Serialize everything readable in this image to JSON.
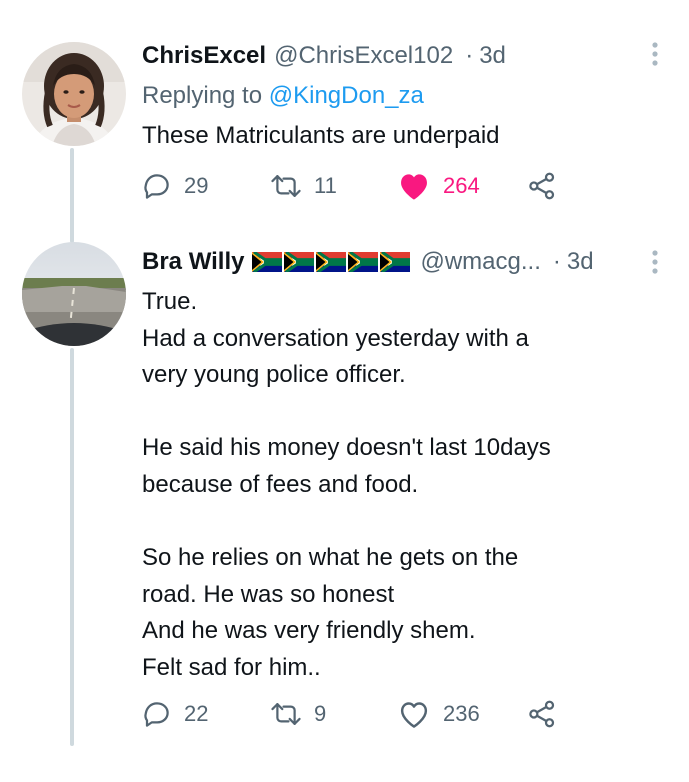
{
  "tweets": [
    {
      "name": "ChrisExcel",
      "handle": "@ChrisExcel102",
      "separator": "·",
      "time": "3d",
      "reply_prefix": "Replying to ",
      "reply_to": "@KingDon_za",
      "text": "These Matriculants are underpaid",
      "replies": "29",
      "retweets": "11",
      "likes": "264",
      "liked": true
    },
    {
      "name": "Bra Willy",
      "flags": [
        "south-africa-flag",
        "south-africa-flag",
        "south-africa-flag",
        "south-africa-flag",
        "south-africa-flag"
      ],
      "handle": "@wmacg...",
      "separator": "·",
      "time": "3d",
      "text": "True.\nHad a conversation yesterday with a\nvery young police officer.\n\nHe said his money doesn't last 10days\nbecause of fees and food.\n\nSo he relies on what he gets on the\nroad. He was so honest\nAnd he was very friendly shem.\nFelt sad for him..",
      "replies": "22",
      "retweets": "9",
      "likes": "236",
      "liked": false
    }
  ],
  "colors": {
    "text": "#0f1419",
    "secondary": "#536471",
    "link": "#1d9bf0",
    "like": "#f91880",
    "thread_line": "#cfd9de"
  }
}
